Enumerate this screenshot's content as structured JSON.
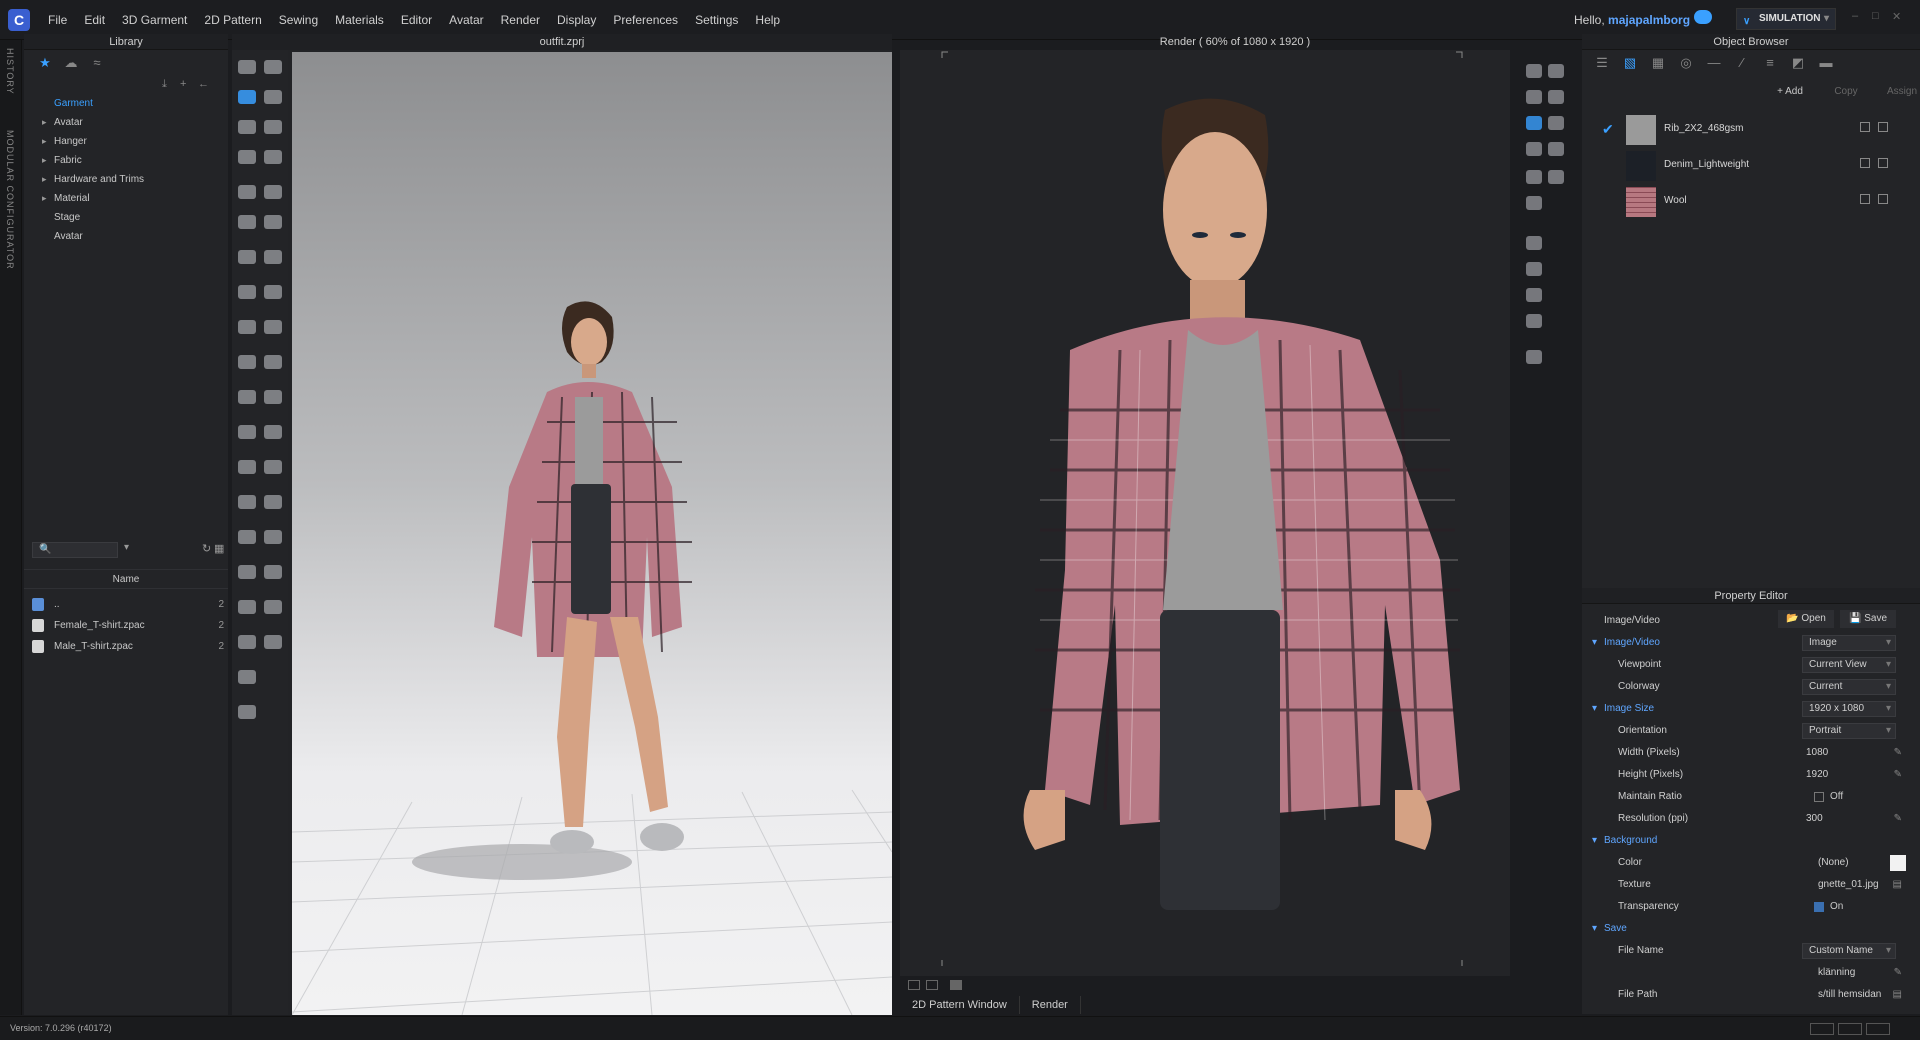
{
  "menu": {
    "items": [
      "File",
      "Edit",
      "3D Garment",
      "2D Pattern",
      "Sewing",
      "Materials",
      "Editor",
      "Avatar",
      "Render",
      "Display",
      "Preferences",
      "Settings",
      "Help"
    ],
    "greeting": "Hello,",
    "username": "majapalmborg",
    "mode": "SIMULATION"
  },
  "left_strip": {
    "history": "HISTORY",
    "modular": "MODULAR CONFIGURATOR"
  },
  "library": {
    "title": "Library",
    "tree": [
      "Garment",
      "Avatar",
      "Hanger",
      "Fabric",
      "Hardware and Trims",
      "Material",
      "Stage",
      "Avatar"
    ],
    "name_header": "Name",
    "files": [
      {
        "name": "..",
        "num": "2"
      },
      {
        "name": "Female_T-shirt.zpac",
        "num": "2"
      },
      {
        "name": "Male_T-shirt.zpac",
        "num": "2"
      }
    ]
  },
  "viewport3d": {
    "title": "outfit.zprj"
  },
  "render": {
    "title": "Render ( 60% of 1080 x 1920 )"
  },
  "bottom_tabs": [
    "2D Pattern Window",
    "Render"
  ],
  "object_browser": {
    "title": "Object Browser",
    "add": "+ Add",
    "copy": "Copy",
    "assign": "Assign",
    "fabrics": [
      {
        "name": "Rib_2X2_468gsm",
        "color": "#9a9a9a",
        "checked": "✔"
      },
      {
        "name": "Denim_Lightweight",
        "color": "#1c2027",
        "checked": ""
      },
      {
        "name": "Wool",
        "color": "#b77880",
        "checked": ""
      }
    ]
  },
  "property_editor": {
    "title": "Property Editor",
    "open": "Open",
    "save": "Save",
    "rows": {
      "imagevideo_label": "Image/Video",
      "imagevideo_section": "Image/Video",
      "imagevideo_value": "Image",
      "viewpoint": "Viewpoint",
      "viewpoint_value": "Current View",
      "colorway": "Colorway",
      "colorway_value": "Current",
      "image_size": "Image Size",
      "image_size_value": "1920 x 1080",
      "orientation": "Orientation",
      "orientation_value": "Portrait",
      "width": "Width (Pixels)",
      "width_value": "1080",
      "height": "Height (Pixels)",
      "height_value": "1920",
      "maintain_ratio": "Maintain Ratio",
      "maintain_ratio_value": "Off",
      "resolution": "Resolution (ppi)",
      "resolution_value": "300",
      "background": "Background",
      "color": "Color",
      "color_value": "(None)",
      "texture": "Texture",
      "texture_value": "gnette_01.jpg",
      "transparency": "Transparency",
      "transparency_value": "On",
      "save_section": "Save",
      "file_name": "File Name",
      "file_name_value": "Custom Name",
      "file_name_text": "klänning",
      "file_path": "File Path",
      "file_path_value": "s/till hemsidan"
    }
  },
  "status": {
    "version": "Version: 7.0.296 (r40172)"
  }
}
